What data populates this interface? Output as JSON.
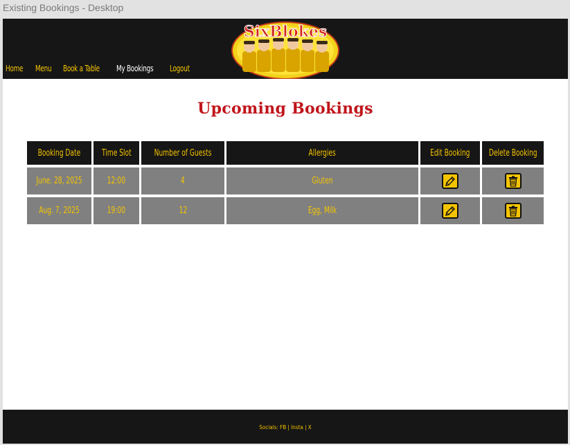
{
  "window": {
    "title": "Existing Bookings - Desktop"
  },
  "nav": {
    "items": [
      {
        "label": "Home",
        "active": false
      },
      {
        "label": "Menu",
        "active": false
      },
      {
        "label": "Book a Table",
        "active": false
      },
      {
        "label": "My Bookings",
        "active": true
      },
      {
        "label": "Logout",
        "active": false
      }
    ]
  },
  "logo": {
    "text": "SixBlokes",
    "alt_icon": "six-blokes-logo"
  },
  "page": {
    "heading": "Upcoming Bookings"
  },
  "table": {
    "headers": [
      "Booking Date",
      "Time Slot",
      "Number of Guests",
      "Allergies",
      "Edit Booking",
      "Delete Booking"
    ],
    "rows": [
      {
        "date": "June. 28, 2025",
        "time": "12:00",
        "guests": "4",
        "allergies": "Gluten"
      },
      {
        "date": "Aug. 7, 2025",
        "time": "19:00",
        "guests": "12",
        "allergies": "Egg, Milk"
      }
    ],
    "edit_icon": "pencil-icon",
    "delete_icon": "trash-icon"
  },
  "footer": {
    "text": "Socials: FB | Insta | X"
  },
  "colors": {
    "header_bg": "#161616",
    "accent_yellow": "#f5c400",
    "heading_red": "#c0151b",
    "row_bg": "#808080",
    "active_nav": "#ffffff"
  }
}
